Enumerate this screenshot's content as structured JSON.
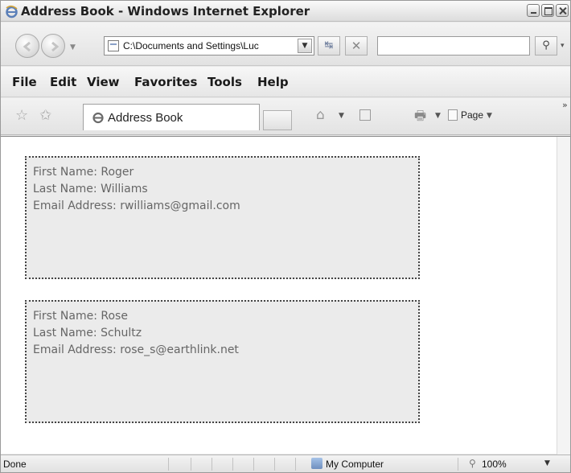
{
  "window": {
    "title": "Address Book - Windows Internet Explorer"
  },
  "address_bar": {
    "url": "C:\\Documents and Settings\\Luc",
    "search_value": ""
  },
  "menu": {
    "items": [
      "File",
      "Edit",
      "View",
      "Favorites",
      "Tools",
      "Help"
    ]
  },
  "toolbar": {
    "tab_label": "Address Book",
    "page_label": "Page"
  },
  "contacts": [
    {
      "first_name": "First Name: Roger",
      "last_name": "Last Name: Williams",
      "email": "Email Address: rwilliams@gmail.com"
    },
    {
      "first_name": "First Name: Rose",
      "last_name": "Last Name: Schultz",
      "email": "Email Address: rose_s@earthlink.net"
    }
  ],
  "status": {
    "text": "Done",
    "zone": "My Computer",
    "zoom": "100%"
  },
  "icons": {
    "app": "ie-logo-icon",
    "back": "back-arrow-icon",
    "forward": "forward-arrow-icon",
    "refresh": "refresh-icon",
    "stop": "stop-icon",
    "search": "magnifier-icon",
    "favorites": "star-icon",
    "add_favorites": "add-favorites-icon",
    "home": "home-icon",
    "feeds": "feeds-icon",
    "print": "printer-icon",
    "page": "page-icon",
    "zone": "computer-icon",
    "zoom": "zoom-icon"
  }
}
